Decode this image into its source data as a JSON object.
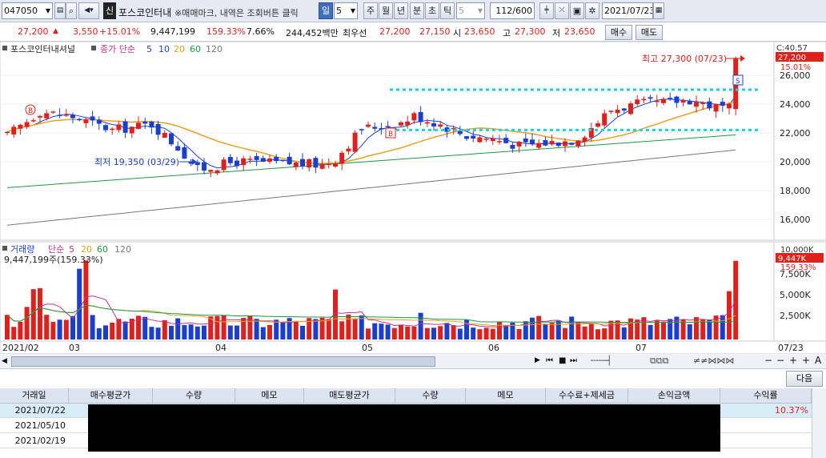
{
  "toolbar": {
    "code": "047050",
    "credit_badge": "신",
    "stock_name": "포스코인터내",
    "notice": "※매매마크, 내역은 조회버튼 클릭",
    "periods": [
      "일",
      "5",
      "주",
      "월",
      "년",
      "분",
      "초",
      "틱"
    ],
    "selected_period": "일",
    "minute_value": "5",
    "count": "112/600",
    "date": "2021/07/23"
  },
  "quote": {
    "price": "27,200",
    "change": "3,550",
    "change_pct": "+15.01%",
    "volume": "9,447,199",
    "volume_pct": "159.33%",
    "turnover": "7.66%",
    "amount": "244,452백만",
    "best_label": "최우선",
    "best_ask": "27,200",
    "best_bid": "27,150",
    "open_label": "시",
    "open": "23,650",
    "high_label": "고",
    "high": "27,300",
    "low_label": "저",
    "low": "23,650",
    "buy_button": "매수",
    "sell_button": "매도"
  },
  "price_chart": {
    "legend_name": "포스코인터내셔널",
    "legend_ma_label": "종가 단순",
    "legend_periods": [
      "5",
      "10",
      "20",
      "60",
      "120"
    ],
    "legend_colors": [
      "#1a3fd0",
      "#1a3fd0",
      "#e8a020",
      "#1a9a40",
      "#777777"
    ],
    "high_annotation": "최고 27,300 (07/23)",
    "low_annotation": "최저 19,350 (03/29)",
    "right_top_label": "C:40.57",
    "right_price_box": "27,200",
    "right_pct": "15.01%",
    "y_ticks": [
      "26,000",
      "24,000",
      "22,000",
      "20,000",
      "18,000",
      "16,000"
    ],
    "marker_buy": "B",
    "marker_sell": "S"
  },
  "volume_chart": {
    "legend_label": "거래량",
    "legend_ma_label": "단순",
    "legend_periods": [
      "5",
      "20",
      "60",
      "120"
    ],
    "volume_readout": "9,447,199주(159.33%)",
    "right_top_label": "10,000K",
    "right_box": "9,447K",
    "right_pct": "159.33%",
    "y_ticks": [
      "7,500K",
      "5,000K",
      "2,500K"
    ]
  },
  "x_axis": [
    "2021/02",
    "03",
    "04",
    "05",
    "06",
    "07",
    "07/23"
  ],
  "tabs": {
    "next_button": "다음"
  },
  "table": {
    "headers": [
      "거래일",
      "매수평균가",
      "수량",
      "메모",
      "매도평균가",
      "수량",
      "메모",
      "수수료+제세금",
      "손익금액",
      "수익률"
    ],
    "rows": [
      {
        "date": "2021/07/22",
        "return": "10.37%"
      },
      {
        "date": "2021/05/10",
        "return": ""
      },
      {
        "date": "2021/02/19",
        "return": ""
      }
    ]
  },
  "chart_data": {
    "type": "candlestick",
    "title": "포스코인터내셔널",
    "ylim": [
      15000,
      27500
    ],
    "period_labels": [
      "2021/02",
      "03",
      "04",
      "05",
      "06",
      "07"
    ],
    "last_close": 27200,
    "high": 27300,
    "low": 19350,
    "support_lines": [
      25000,
      22200
    ]
  }
}
